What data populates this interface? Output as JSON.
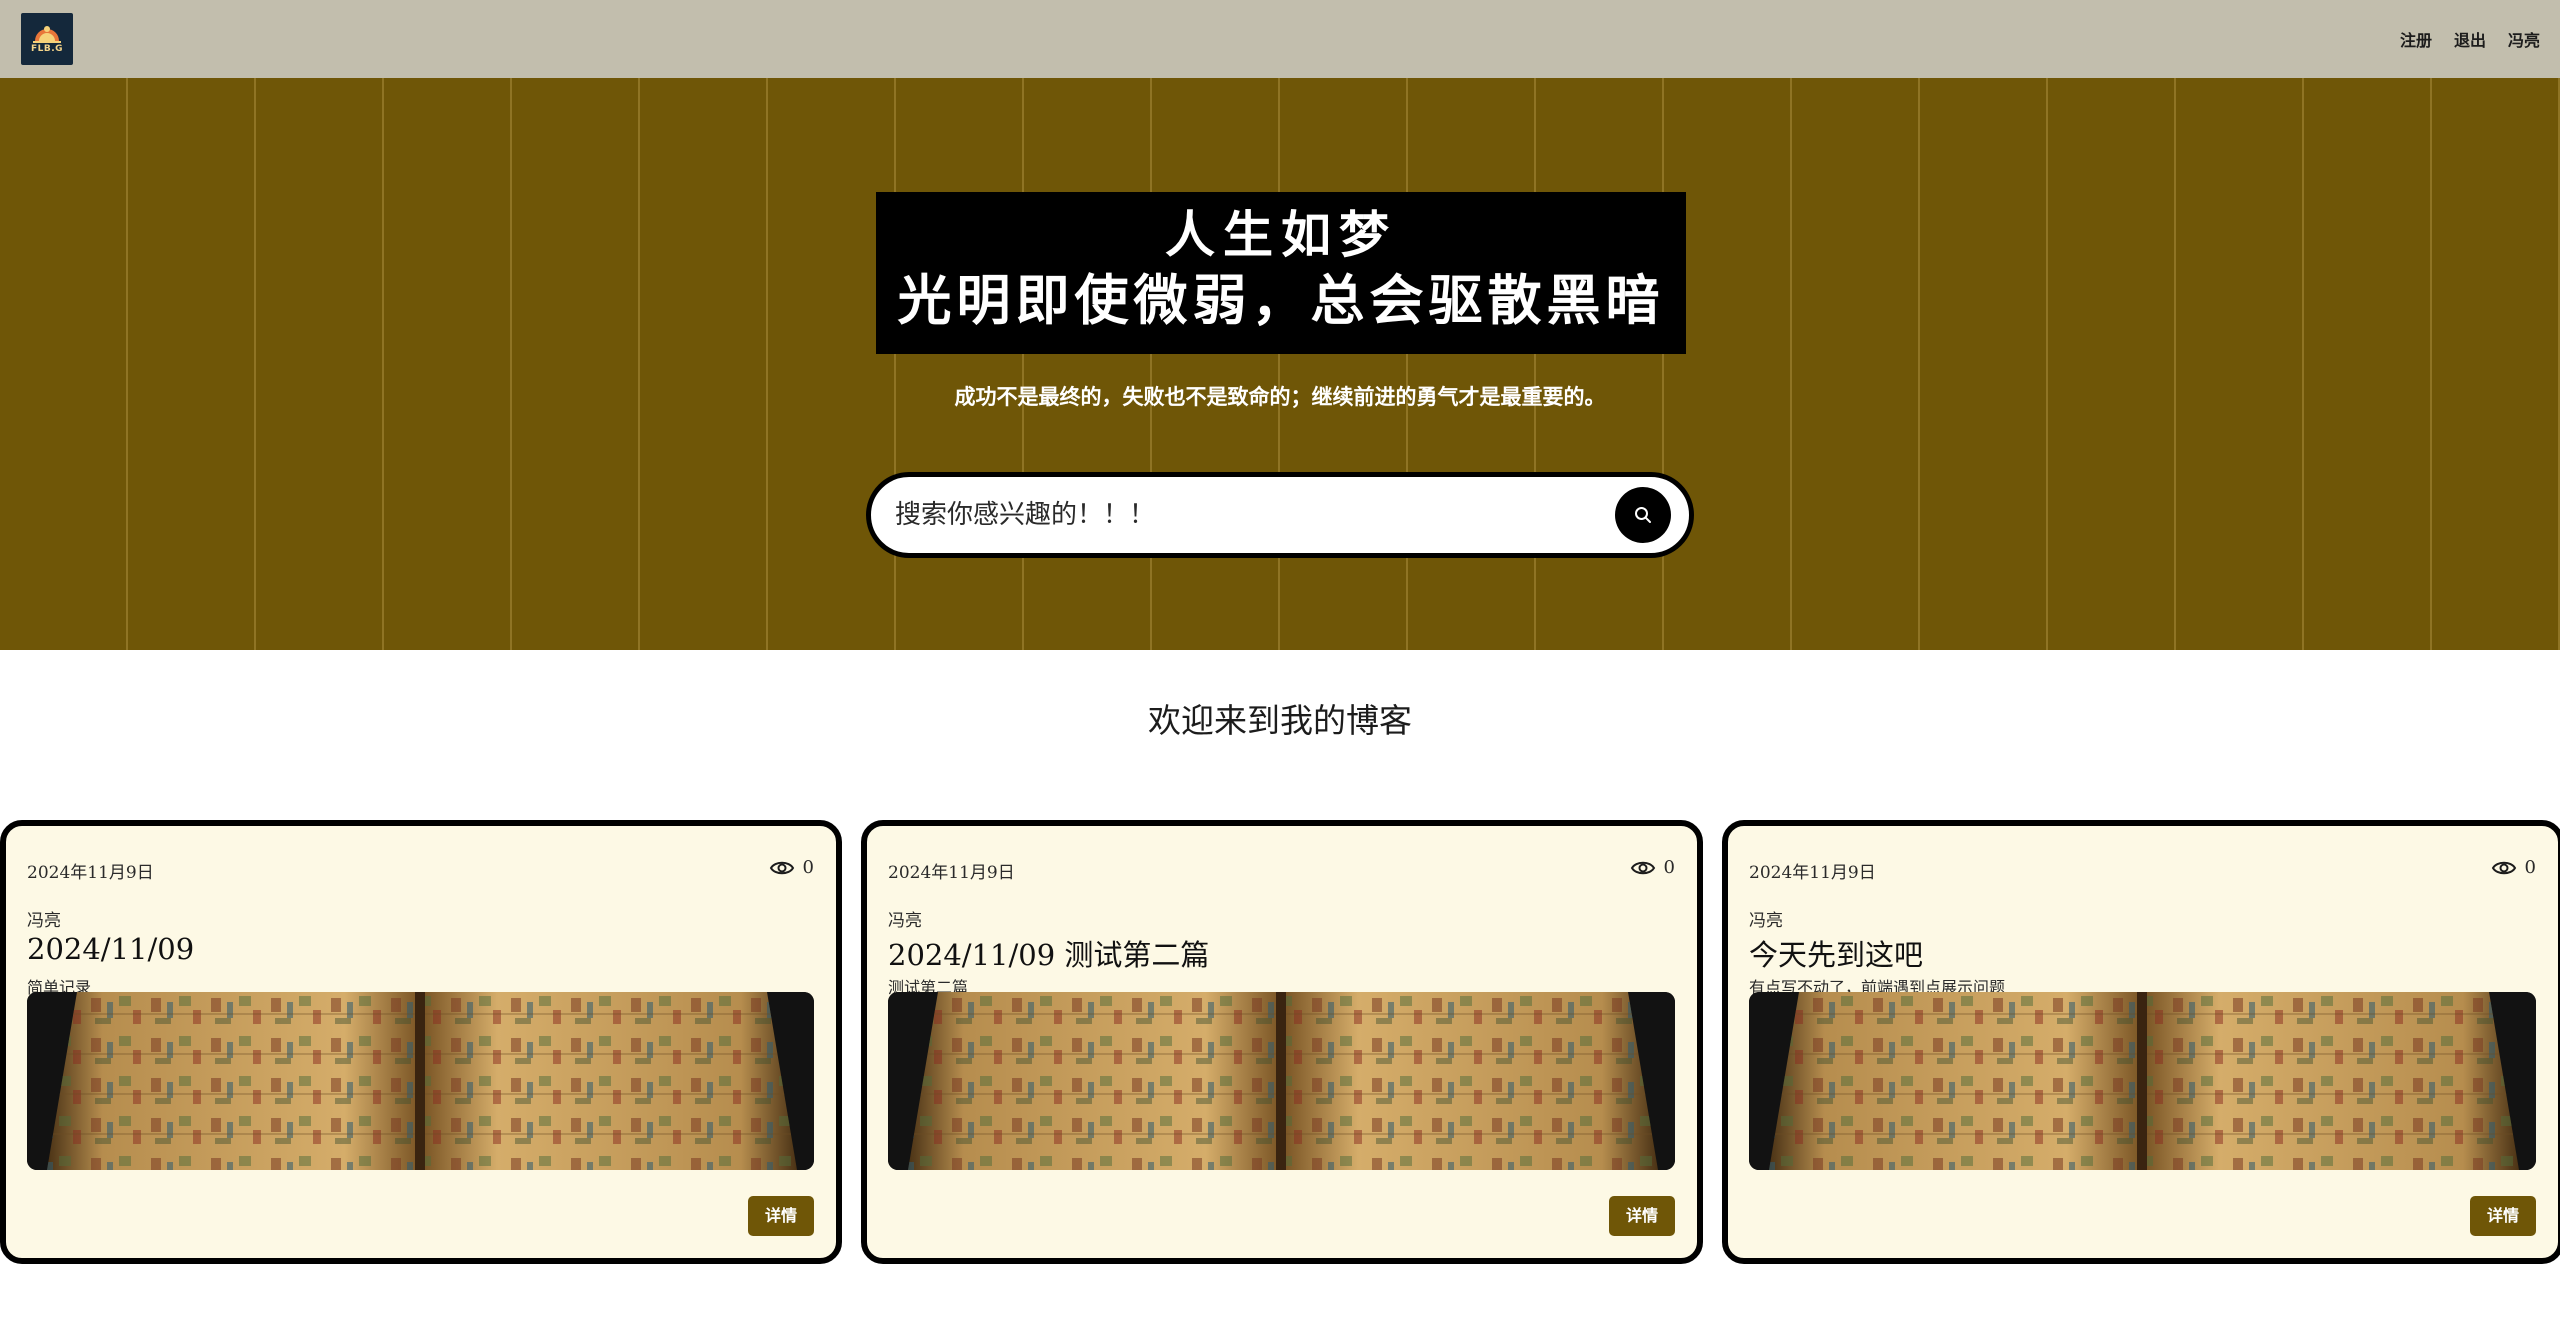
{
  "header": {
    "logo_text": "FLB.G",
    "nav": [
      "注册",
      "退出",
      "冯亮"
    ]
  },
  "hero": {
    "motto_line1": "人生如梦",
    "motto_line2": "光明即使微弱，总会驱散黑暗",
    "subtitle": "成功不是最终的，失败也不是致命的；继续前进的勇气才是最重要的。",
    "search_placeholder": "搜索你感兴趣的！！！"
  },
  "welcome": "欢迎来到我的博客",
  "posts": [
    {
      "date": "2024年11月9日",
      "views": "0",
      "author": "冯亮",
      "title": "2024/11/09",
      "summary": "简单记录",
      "button": "详情"
    },
    {
      "date": "2024年11月9日",
      "views": "0",
      "author": "冯亮",
      "title": "2024/11/09 测试第二篇",
      "summary": "测试第二篇",
      "button": "详情"
    },
    {
      "date": "2024年11月9日",
      "views": "0",
      "author": "冯亮",
      "title": "今天先到这吧",
      "summary": "有点写不动了，前端遇到点展示问题",
      "button": "详情"
    }
  ],
  "colors": {
    "nav_bg": "#c2bead",
    "hero_bg": "#6f5607",
    "card_bg": "#fdf9e5",
    "button_bg": "#6f5607"
  },
  "icons": {
    "search": "search-icon",
    "views": "eye-icon"
  }
}
